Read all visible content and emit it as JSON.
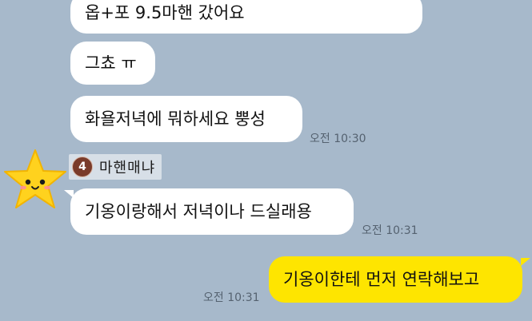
{
  "chat": {
    "messages": [
      {
        "text": "옵+포 9.5마핸 갔어요",
        "side": "received"
      },
      {
        "text": "그쵸 ㅠ",
        "side": "received"
      },
      {
        "text": "화욜저녁에 뭐하세요 뿡성",
        "side": "received",
        "time": "오전 10:30"
      },
      {
        "text": "기옹이랑해서 저녁이나 드실래용",
        "side": "received",
        "time": "오전 10:31"
      },
      {
        "text": "기옹이한테 먼저 연락해보고",
        "side": "sent",
        "time": "오전 10:31"
      }
    ],
    "sender": {
      "name": "마핸매냐",
      "badge_text": "4",
      "avatar_icon": "star-face-icon"
    }
  },
  "colors": {
    "background": "#a7b9cb",
    "received_bubble": "#ffffff",
    "sent_bubble": "#fee500",
    "avatar_star": "#ffd21e"
  }
}
